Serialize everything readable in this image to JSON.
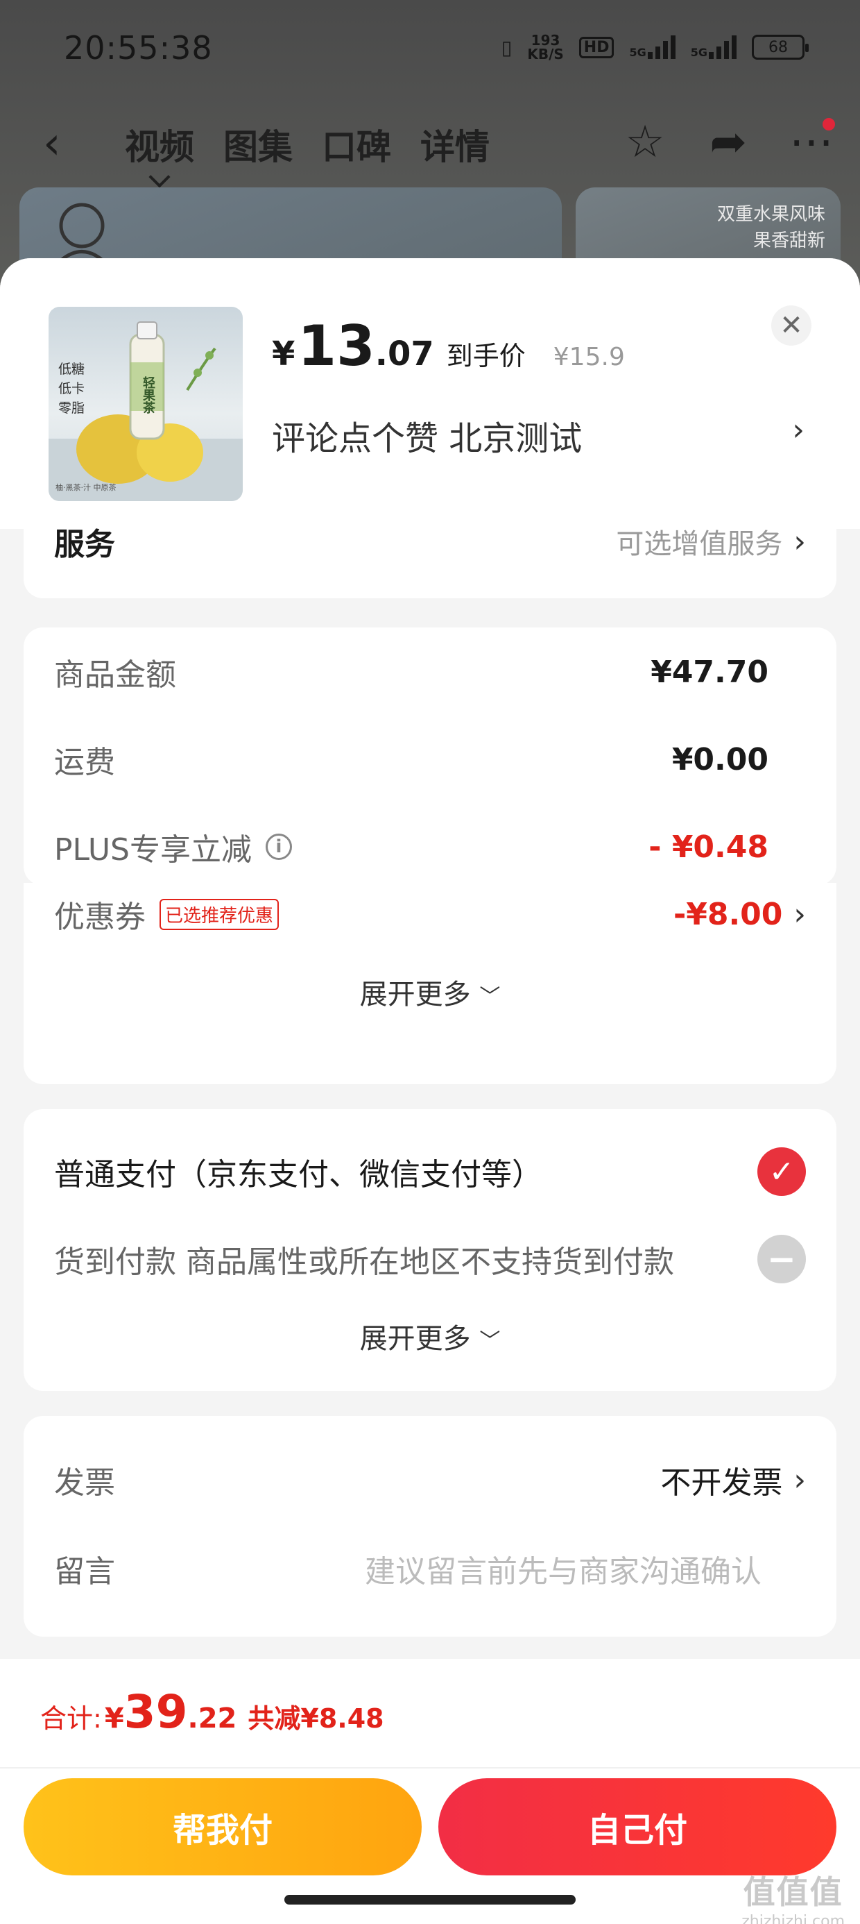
{
  "status_bar": {
    "time": "20:55:38",
    "net_speed_value": "193",
    "net_speed_unit": "KB/S",
    "hd_label": "HD",
    "signal1_label": "5G",
    "signal2_label": "5G",
    "battery": "68"
  },
  "nav": {
    "tabs": [
      {
        "label": "视频"
      },
      {
        "label": "图集"
      },
      {
        "label": "口碑"
      },
      {
        "label": "详情"
      }
    ],
    "active_tab": 0
  },
  "background_banner": {
    "right_text_1": "双重水果风味",
    "right_text_2": "果香甜新"
  },
  "product": {
    "price_currency": "¥",
    "price_integer": "13",
    "price_decimal": ".07",
    "price_tag": "到手价",
    "original_price": "¥15.9",
    "spec_text": "评论点个赞  北京测试",
    "thumb_text_1": "低糖",
    "thumb_text_2": "低卡",
    "thumb_text_3": "零脂",
    "thumb_bottle_label": "轻果茶",
    "thumb_caption": "柚·黑茶·汁  中原茶"
  },
  "service": {
    "label": "服务",
    "value": "可选增值服务"
  },
  "amounts": {
    "goods_label": "商品金额",
    "goods_value": "¥47.70",
    "shipping_label": "运费",
    "shipping_value": "¥0.00",
    "plus_label": "PLUS专享立减",
    "plus_value": "- ¥0.48",
    "coupon_label": "优惠券",
    "coupon_badge": "已选推荐优惠",
    "coupon_value": "-¥8.00",
    "expand_label": "展开更多"
  },
  "payment": {
    "normal_label": "普通支付（京东支付、微信支付等）",
    "cod_label": "货到付款 商品属性或所在地区不支持货到付款",
    "expand_label": "展开更多"
  },
  "invoice": {
    "invoice_label": "发票",
    "invoice_value": "不开发票",
    "message_label": "留言",
    "message_placeholder": "建议留言前先与商家沟通确认"
  },
  "footer": {
    "total_label": "合计:",
    "total_currency": "¥",
    "total_integer": "39",
    "total_decimal": ".22",
    "saving_text": "共减¥8.48",
    "help_pay_label": "帮我付",
    "self_pay_label": "自己付",
    "watermark_main": "值值值",
    "watermark_sub": "zhizhizhi.com"
  },
  "colors": {
    "accent_red": "#e2231a",
    "button_yellow": "#ffb012",
    "button_red": "#f5333f"
  }
}
